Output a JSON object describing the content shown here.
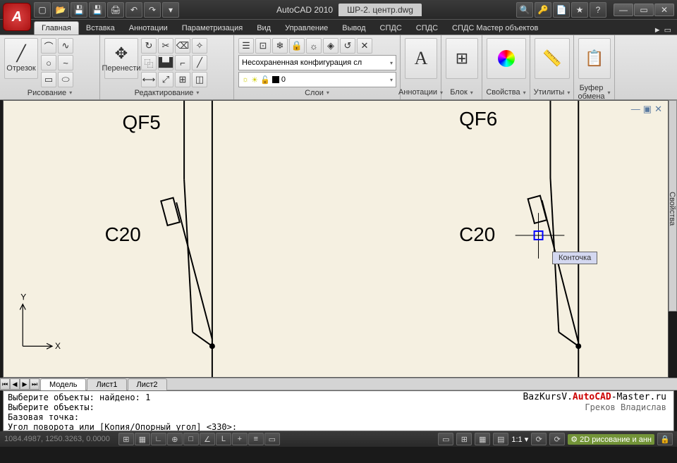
{
  "app": {
    "name": "AutoCAD 2010",
    "document": "ШР-2. центр.dwg",
    "logo_letter": "A"
  },
  "qat": [
    {
      "n": "new",
      "g": "▢"
    },
    {
      "n": "open",
      "g": "📂"
    },
    {
      "n": "save",
      "g": "💾"
    },
    {
      "n": "saveas",
      "g": "💾"
    },
    {
      "n": "plot",
      "g": "🖨"
    },
    {
      "n": "undo",
      "g": "↶"
    },
    {
      "n": "redo",
      "g": "↷"
    },
    {
      "n": "more",
      "g": "▾"
    }
  ],
  "title_right": [
    {
      "n": "binoculars",
      "g": "🔍"
    },
    {
      "n": "key",
      "g": "🔑"
    },
    {
      "n": "sheet",
      "g": "📄"
    },
    {
      "n": "star",
      "g": "★"
    },
    {
      "n": "help",
      "g": "?"
    },
    {
      "n": "dd",
      "g": "▾"
    }
  ],
  "ribbon_tabs": [
    "Главная",
    "Вставка",
    "Аннотации",
    "Параметризация",
    "Вид",
    "Управление",
    "Вывод",
    "СПДС",
    "СПДС",
    "СПДС Мастер объектов"
  ],
  "ribbon_active": 0,
  "ribbon_more": "►",
  "panels": {
    "draw": {
      "label": "Рисование",
      "big_label": "Отрезок"
    },
    "modify": {
      "label": "Редактирование",
      "big_label": "Перенести"
    },
    "layers": {
      "label": "Слои",
      "dd": "Несохраненная конфигурация сл",
      "layer": "0"
    },
    "anno": {
      "label": "Аннотации"
    },
    "block": {
      "label": "Блок"
    },
    "props": {
      "label": "Свойства"
    },
    "utils": {
      "label": "Утилиты"
    },
    "clip": {
      "label": "Буфер обмена"
    }
  },
  "canvas": {
    "labels": {
      "qf5": "QF5",
      "qf6": "QF6",
      "c20a": "C20",
      "c20b": "C20"
    },
    "axis": {
      "x": "X",
      "y": "Y"
    },
    "tooltip": "Конточка"
  },
  "doc_tabs": [
    "Модель",
    "Лист1",
    "Лист2"
  ],
  "cmd": {
    "l1": "Выберите объекты: найдено: 1",
    "l2": "Выберите объекты:",
    "l3": "Базовая точка:",
    "l4": "Угол поворота или [Копия/Опорный угол] <330>:"
  },
  "site": {
    "pre": "BazKursV.",
    "mid": "AutoCAD",
    "post": "-Master.ru",
    "author": "Греков Владислав"
  },
  "status": {
    "coords": "1084.4987, 1250.3263, 0.0000",
    "ratio": "1:1",
    "workspace": "2D рисование и анн"
  },
  "side_panel": "Свойства"
}
